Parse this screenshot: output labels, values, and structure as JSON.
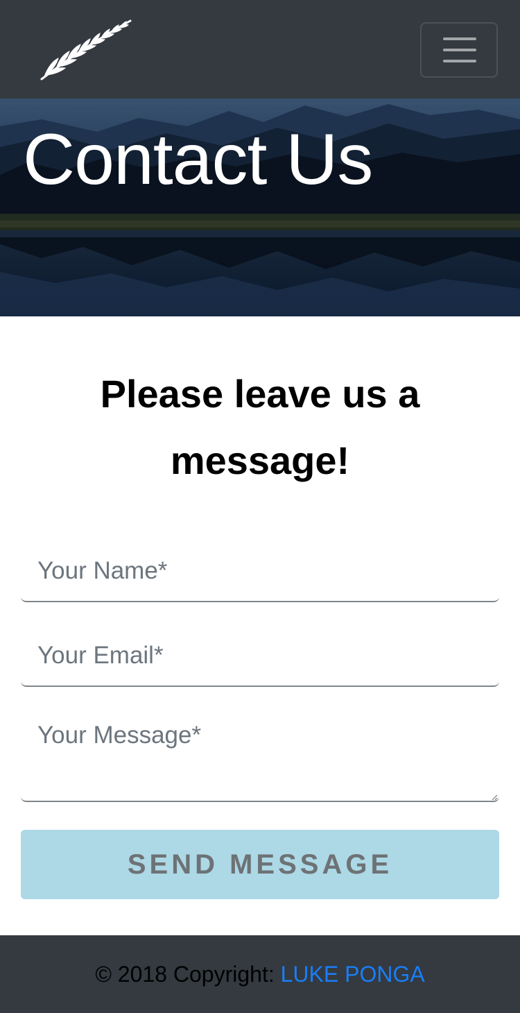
{
  "navbar": {
    "logo_icon": "silver-fern-icon",
    "menu_icon": "hamburger-menu-icon"
  },
  "hero": {
    "title": "Contact Us"
  },
  "form": {
    "heading_line1": "Please leave us a",
    "heading_line2": "message!",
    "name_placeholder": "Your Name*",
    "email_placeholder": "Your Email*",
    "message_placeholder": "Your Message*",
    "submit_label": "SEND MESSAGE"
  },
  "footer": {
    "copyright_prefix": "© 2018 Copyright: ",
    "author_link": "LUKE PONGA"
  },
  "colors": {
    "navbar_bg": "#343a40",
    "button_bg": "#add8e6",
    "button_text": "#6d7275",
    "link": "#1a7ef5"
  }
}
